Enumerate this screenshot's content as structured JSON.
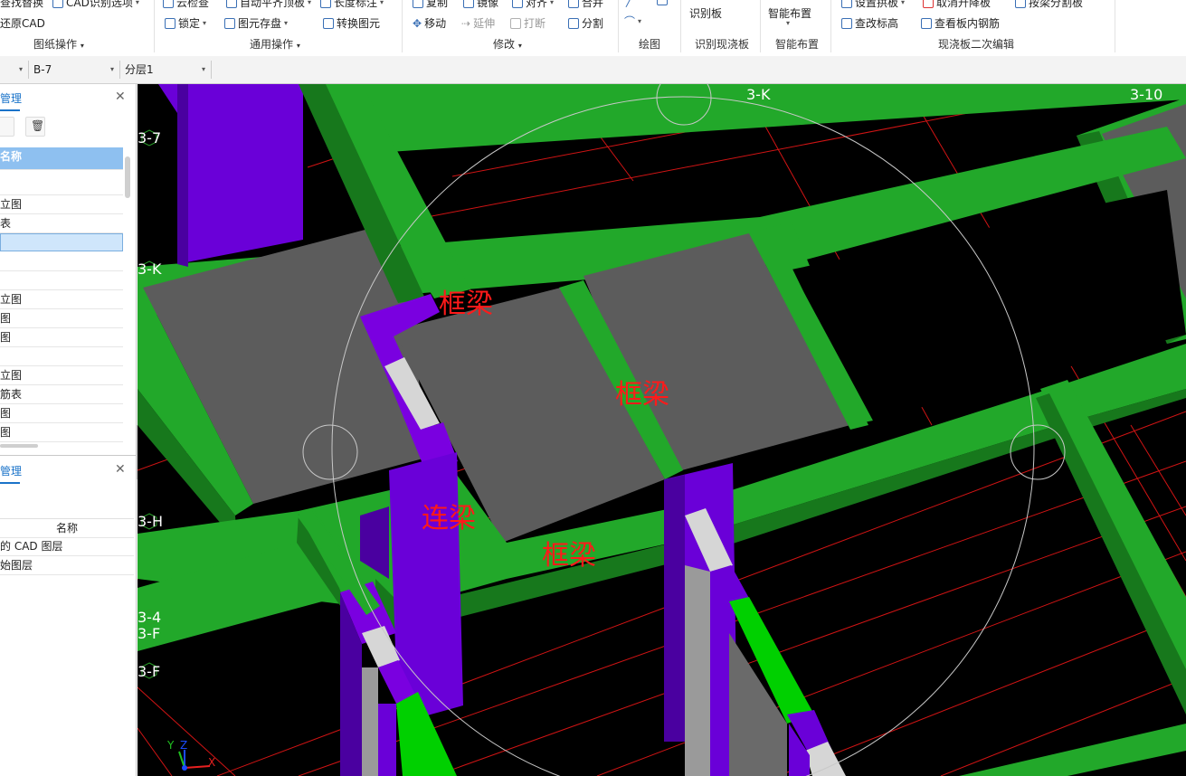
{
  "ribbon": {
    "row1": {
      "find_replace": "查找替换",
      "cad_options": "CAD识别选项",
      "cloud_check": "云检查",
      "auto_flat_slab": "自动平齐顶板",
      "length_annotation": "长度标注",
      "copy": "复制",
      "mirror": "镜像",
      "align": "对齐",
      "merge": "合并",
      "set_slope": "设置拱板",
      "cancel_lift": "取消升降板",
      "split_by_beam": "按梁分割板"
    },
    "restore_cad": "还原CAD",
    "lock": "锁定",
    "store_element": "图元存盘",
    "convert_element": "转换图元",
    "move": "移动",
    "extend": "延伸",
    "break": "打断",
    "split": "分割",
    "identify_slab": "识别板",
    "smart_layout": "智能布置",
    "modify_elevation": "查改标高",
    "view_slab_rebar": "查看板内钢筋",
    "groups": {
      "drawing_ops": "图纸操作",
      "general_ops": "通用操作",
      "modify": "修改",
      "draw": "绘图",
      "identify_cast_slab": "识别现浇板",
      "smart_layout": "智能布置",
      "cast_slab_secondary_edit": "现浇板二次编辑"
    }
  },
  "toolbar2": {
    "component": "B-7",
    "layer": "分层1"
  },
  "sidebar": {
    "panel1_tab": "管理",
    "panel1_rows": [
      "名称",
      "",
      "立图",
      "表",
      "",
      "",
      "",
      "立图",
      "图",
      "图",
      "",
      "立图",
      "筋表",
      "图",
      "图"
    ],
    "panel2_tab": "管理",
    "panel2_header": "名称",
    "panel2_rows": [
      "的 CAD 图层",
      "始图层"
    ]
  },
  "viewport": {
    "axis_labels": [
      "3-K",
      "3-10",
      "3-7",
      "3-K",
      "3-H",
      "3-4",
      "3-F",
      "3-F"
    ],
    "beam_labels": [
      "框梁",
      "框梁",
      "连梁",
      "框梁"
    ],
    "coord": {
      "y": "Y",
      "z": "Z",
      "x": "X"
    }
  },
  "colors": {
    "beam_green": "#22a82a",
    "beam_green_dark": "#17781c",
    "column_purple": "#6a00d8",
    "slab_gray": "#5c5c5c",
    "grid_red": "#e01818",
    "label_red": "#ff1a1a"
  }
}
